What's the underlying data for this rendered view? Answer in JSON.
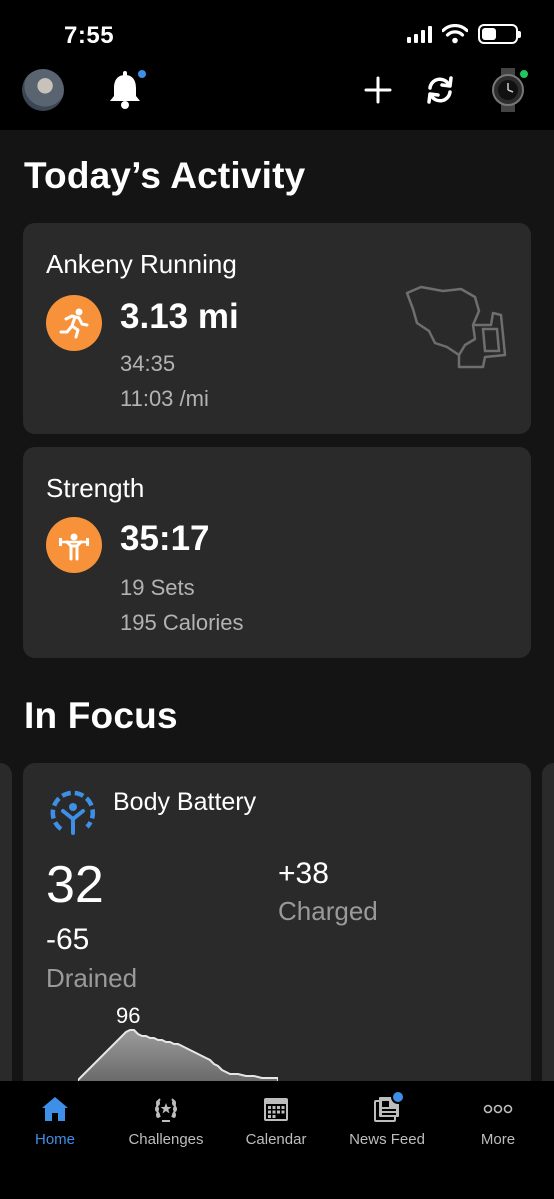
{
  "status": {
    "time": "7:55"
  },
  "toolbar": {
    "notification_dot_color": "#3e8fe8",
    "device_dot_color": "#22c55e",
    "icons": [
      "avatar",
      "bell-icon",
      "plus-icon",
      "sync-icon",
      "watch-icon"
    ]
  },
  "today": {
    "title": "Today’s Activity",
    "activities": [
      {
        "name": "Ankeny Running",
        "icon": "running-icon",
        "main": "3.13 mi",
        "line1": "34:35",
        "line2": "11:03 /mi"
      },
      {
        "name": "Strength",
        "icon": "weightlifting-icon",
        "main": "35:17",
        "line1": "19 Sets",
        "line2": "195 Calories"
      }
    ]
  },
  "focus": {
    "title": "In Focus",
    "body_battery": {
      "title": "Body Battery",
      "current": "32",
      "drained_value": "-65",
      "drained_label": "Drained",
      "charged_value": "+38",
      "charged_label": "Charged",
      "peak_label": "96",
      "accent_color": "#3e8fe8"
    }
  },
  "tabs": [
    {
      "label": "Home",
      "icon": "home-icon",
      "active": true
    },
    {
      "label": "Challenges",
      "icon": "laurel-icon",
      "active": false
    },
    {
      "label": "Calendar",
      "icon": "calendar-icon",
      "active": false
    },
    {
      "label": "News Feed",
      "icon": "news-feed-icon",
      "active": false
    },
    {
      "label": "More",
      "icon": "more-icon",
      "active": false
    }
  ],
  "colors": {
    "activity_orange": "#f7923a",
    "active_tab": "#3e8fe8",
    "card_bg": "#2a2a2a"
  }
}
